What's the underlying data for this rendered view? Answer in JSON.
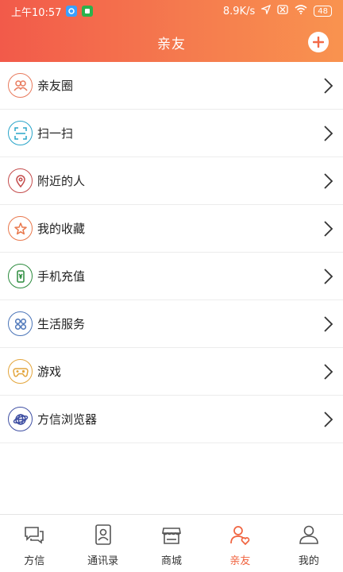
{
  "status_bar": {
    "time": "上午10:57",
    "network_speed": "8.9K/s",
    "battery": "48"
  },
  "header": {
    "title": "亲友"
  },
  "menu": {
    "items": [
      {
        "label": "亲友圈",
        "icon": "friends-circle-icon",
        "color": "#e87a5d"
      },
      {
        "label": "扫一扫",
        "icon": "scan-icon",
        "color": "#29a5c9"
      },
      {
        "label": "附近的人",
        "icon": "location-pin-icon",
        "color": "#c44b4b"
      },
      {
        "label": "我的收藏",
        "icon": "star-icon",
        "color": "#e9774b"
      },
      {
        "label": "手机充值",
        "icon": "phone-recharge-icon",
        "color": "#2b8b3d"
      },
      {
        "label": "生活服务",
        "icon": "grid-flower-icon",
        "color": "#4a74b8"
      },
      {
        "label": "游戏",
        "icon": "gamepad-icon",
        "color": "#e3a53b"
      },
      {
        "label": "方信浏览器",
        "icon": "globe-icon",
        "color": "#3f4fa3"
      }
    ]
  },
  "tabs": [
    {
      "label": "方信",
      "icon": "chat-icon",
      "active": false
    },
    {
      "label": "通讯录",
      "icon": "contacts-icon",
      "active": false
    },
    {
      "label": "商城",
      "icon": "store-icon",
      "active": false
    },
    {
      "label": "亲友",
      "icon": "friends-heart-icon",
      "active": true
    },
    {
      "label": "我的",
      "icon": "user-icon",
      "active": false
    }
  ],
  "colors": {
    "header_start": "#f25a4a",
    "header_end": "#f9934f",
    "accent": "#f0633f"
  }
}
